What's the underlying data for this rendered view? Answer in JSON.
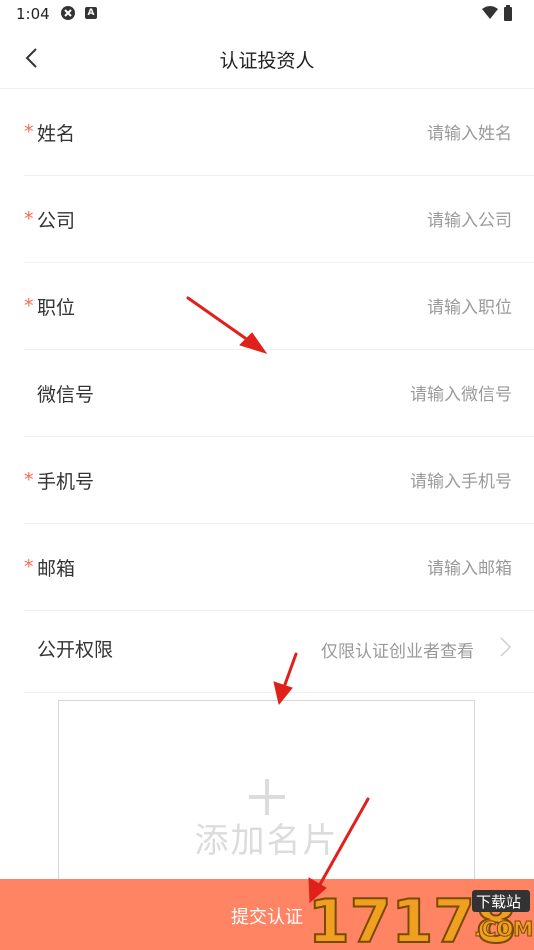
{
  "status_bar": {
    "time": "1:04"
  },
  "nav": {
    "title": "认证投资人"
  },
  "form": {
    "rows": [
      {
        "label": "姓名",
        "placeholder": "请输入姓名",
        "required": true
      },
      {
        "label": "公司",
        "placeholder": "请输入公司",
        "required": true
      },
      {
        "label": "职位",
        "placeholder": "请输入职位",
        "required": true
      },
      {
        "label": "微信号",
        "placeholder": "请输入微信号",
        "required": false
      },
      {
        "label": "手机号",
        "placeholder": "请输入手机号",
        "required": true
      },
      {
        "label": "邮箱",
        "placeholder": "请输入邮箱",
        "required": true
      }
    ],
    "permission": {
      "label": "公开权限",
      "value": "仅限认证创业者查看"
    },
    "required_mark": "*"
  },
  "upload": {
    "label": "添加名片"
  },
  "submit": {
    "label": "提交认证"
  },
  "watermark": {
    "number": "17178",
    "tag": "下载站",
    "domain": ".COM"
  },
  "colors": {
    "accent": "#ff8464",
    "required": "#ff6a4d",
    "annotation_arrow": "#e0201a"
  }
}
